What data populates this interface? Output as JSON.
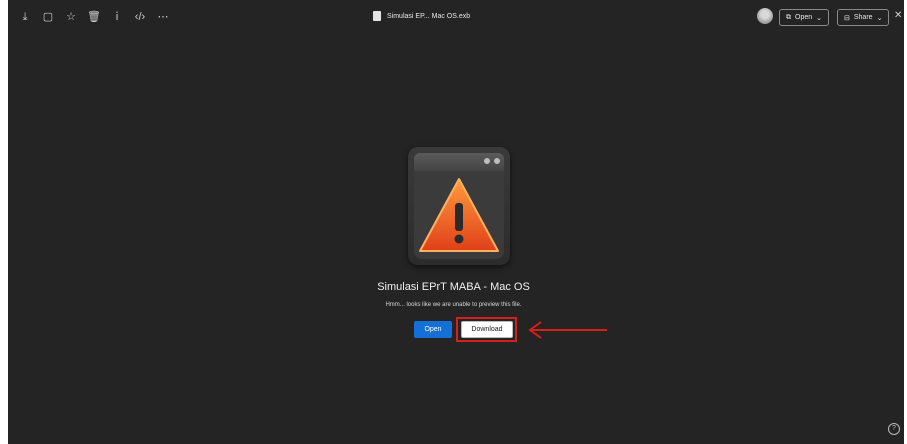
{
  "topbar": {
    "icons": [
      "download-icon",
      "comment-icon",
      "star-icon",
      "trash-icon",
      "info-icon",
      "code-icon",
      "more-icon"
    ],
    "file_title": "Simulasi EP... Mac OS.exb",
    "open_label": "Open",
    "share_label": "Share"
  },
  "preview": {
    "title": "Simulasi EPrT MABA - Mac OS",
    "message": "Hmm... looks like we are unable to preview this file.",
    "open_button": "Open",
    "download_button": "Download"
  },
  "colors": {
    "background": "#242424",
    "accent_blue": "#1570d5",
    "highlight_red": "#d41f1f"
  }
}
